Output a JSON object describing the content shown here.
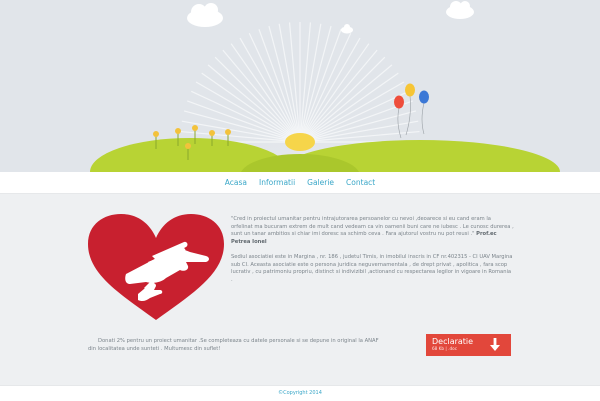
{
  "nav": {
    "items": [
      "Acasa",
      "Informatii",
      "Galerie",
      "Contact"
    ]
  },
  "content": {
    "quote_text": "\"Cred in proiectul umanitar pentru intrajutorarea persoanelor cu nevoi ,deoarece si eu cand eram la orfelinat ma bucuram extrem de mult cand vedeam ca vin oamenii buni care ne iubesc . Le cunosc durerea , sunt un tanar ambitios si chiar imi doresc sa schimb ceva . Fara ajutorul vostru nu pot reusi .\"",
    "quote_author": "Prof.ec Petrea Ionel",
    "info_text": "Sediul asociatiei este in Margina , nr. 186 , judetul Timis, in imobilul inscris in CF nr.402315 - CI UAV Margina sub CI. Aceasta asociatie este o persona juridica neguvernamentala , de drept privat , apolitica , fara scop lucrativ , cu patrimoniu propriu, distinct si indivizibil ,actionand cu respectarea legilor in vigoare in Romania .",
    "donate_line1": "Donati 2% pentru un proiect umanitar .Se completeaza cu datele personale si se depune in original la ANAF",
    "donate_line2": "din localitatea unde sunteti . Multumesc din suflet!"
  },
  "download": {
    "title": "Declaratie",
    "subtitle": "68 Kb | .doc"
  },
  "footer": {
    "copyright": "©Copyright 2014"
  },
  "icons": {
    "download": "arrow-down-icon",
    "logo": "heart-hands-logo"
  },
  "colors": {
    "accent": "#3aa7c8",
    "heart": "#c8202f",
    "button": "#e2473b",
    "hill": "#b8d334",
    "sky": "#e1e5ea"
  }
}
